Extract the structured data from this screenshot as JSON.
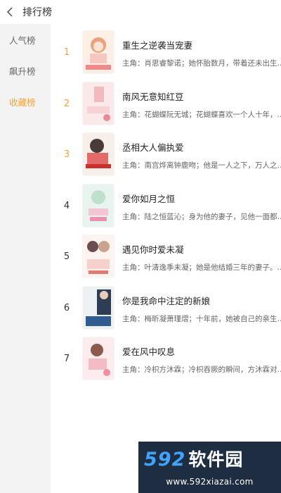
{
  "header": {
    "title": "排行榜"
  },
  "sidebar": {
    "items": [
      {
        "label": "人气榜",
        "active": false
      },
      {
        "label": "飙升榜",
        "active": false
      },
      {
        "label": "收藏榜",
        "active": true
      }
    ]
  },
  "books": [
    {
      "rank": "1",
      "title": "重生之逆袭当宠妻",
      "desc": "主角：肖思睿黎诺；她怀胎数月，带着还未出生…"
    },
    {
      "rank": "2",
      "title": "南风无意知红豆",
      "desc": "主角：花蝴蝶阮无城；花蝴蝶喜欢一个人十年，…"
    },
    {
      "rank": "3",
      "title": "丞相大人偏执爱",
      "desc": "主角：南宫烨离钟鹿吻；他是一人之下，万人之…"
    },
    {
      "rank": "4",
      "title": "爱你如月之恒",
      "desc": "主角：陆之恒蓝沁；身为他的妻子，见他一面都…"
    },
    {
      "rank": "5",
      "title": "遇见你时爱未凝",
      "desc": "主角：叶清逸季未凝；她是他结婚三年的妻子。…"
    },
    {
      "rank": "6",
      "title": "你是我命中注定的新娘",
      "desc": "主角：梅昕凝萧瑾熠；十年前，她被自己的亲生…"
    },
    {
      "rank": "7",
      "title": "爱在风中叹息",
      "desc": "主角：冷枳方沐霖；冷枳吞厥的瞬间，方沐霖对…"
    }
  ],
  "watermark": {
    "brand": "592",
    "brand_cn": "软件园",
    "url": "www.592xiazai.com"
  },
  "colors": {
    "accent": "#f2a33a",
    "sidebar_bg": "#f3f3f3",
    "watermark_bg": "#1f2d42"
  }
}
